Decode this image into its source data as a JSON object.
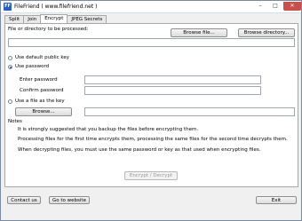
{
  "window": {
    "icon_text": "FF",
    "title": "FileFriend ( www.filefriend.net )",
    "min_glyph": "–",
    "max_glyph": "□",
    "close_glyph": "✕"
  },
  "tabs": [
    "Split",
    "Join",
    "Encrypt",
    "JPEG Secrets"
  ],
  "active_tab": "Encrypt",
  "encrypt": {
    "file_label": "File or directory to be processed:",
    "file_value": "",
    "browse_file_label": "Browse file...",
    "browse_directory_label": "Browse directory...",
    "option_default_key": "Use default public key",
    "option_password": "Use password",
    "selected_option": "Use password",
    "enter_password_label": "Enter password",
    "confirm_password_label": "Confirm password",
    "enter_password_value": "",
    "confirm_password_value": "",
    "option_file_key": "Use a file as the key",
    "browse_key_label": "Browse...",
    "key_file_value": "",
    "notes_title": "Notes",
    "notes": [
      "It is strongly suggested that you backup the files before encrypting them.",
      "Processing files for the first time encrypts them, processing the same files for the second time decrypts them.",
      "When decrypting files, you must use the same password or key as that used when encrypting files."
    ],
    "action_label": "Encrypt / Decrypt"
  },
  "footer": {
    "contact_label": "Contact us",
    "website_label": "Go to website",
    "exit_label": "Exit"
  }
}
